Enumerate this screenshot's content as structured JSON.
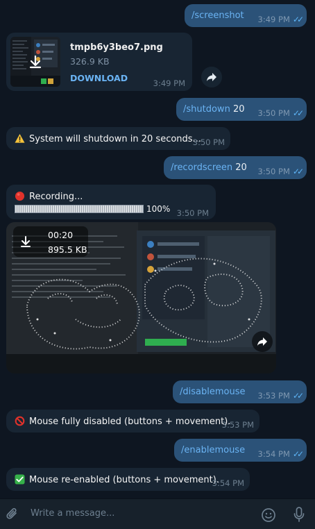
{
  "messages": {
    "m1": {
      "command": "/screenshot",
      "arg": "",
      "time": "3:49 PM"
    },
    "file": {
      "name": "tmpb6y3beo7.png",
      "size": "326.9 KB",
      "download_label": "DOWNLOAD",
      "time": "3:49 PM"
    },
    "m2": {
      "command": "/shutdown",
      "arg": " 20",
      "time": "3:50 PM"
    },
    "m3": {
      "text": "System will shutdown in 20 seconds...",
      "time": "3:50 PM"
    },
    "m4": {
      "command": "/recordscreen",
      "arg": " 20",
      "time": "3:50 PM"
    },
    "m5": {
      "line1": "Recording...",
      "progress_label": "100%",
      "progress": 1.0,
      "time": "3:50 PM"
    },
    "video": {
      "duration": "00:20",
      "size": "895.5 KB"
    },
    "m6": {
      "command": "/disablemouse",
      "arg": "",
      "time": "3:53 PM"
    },
    "m7": {
      "text": "Mouse fully disabled (buttons + movement).",
      "time": "3:53 PM"
    },
    "m8": {
      "command": "/enablemouse",
      "arg": "",
      "time": "3:54 PM"
    },
    "m9": {
      "text": "Mouse re-enabled (buttons + movement).",
      "time": "3:54 PM"
    }
  },
  "input": {
    "placeholder": "Write a message..."
  },
  "icons": {
    "attach": "paperclip-icon",
    "emoji": "smile-icon",
    "mic": "microphone-icon",
    "share": "forward-arrow-icon",
    "download": "download-arrow-icon",
    "warning": "warning-emoji",
    "recording": "red-circle-emoji",
    "disabled": "prohibited-emoji",
    "enabled": "check-mark-emoji"
  },
  "colors": {
    "background": "#0e1621",
    "outgoing_bubble": "#2b5278",
    "incoming_bubble": "#182533",
    "link": "#6ab3f3",
    "read_check": "#5eb5f7",
    "input_bar": "#17212b"
  }
}
